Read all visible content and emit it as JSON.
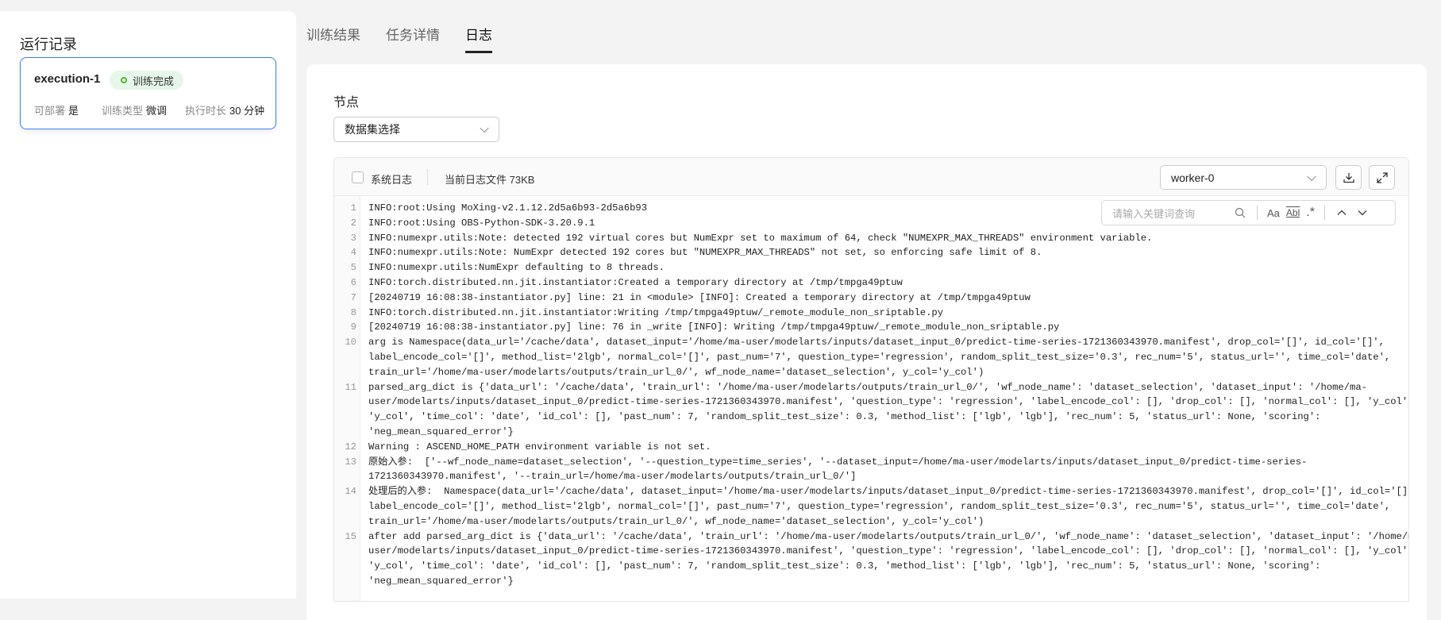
{
  "left": {
    "title": "运行记录",
    "card": {
      "name": "execution-1",
      "status": "训练完成",
      "deployable_label": "可部署",
      "deployable_value": "是",
      "type_label": "训练类型",
      "type_value": "微调",
      "duration_label": "执行时长",
      "duration_value": "30 分钟"
    }
  },
  "tabs": [
    {
      "label": "训练结果"
    },
    {
      "label": "任务详情"
    },
    {
      "label": "日志"
    }
  ],
  "node": {
    "label": "节点",
    "selected": "数据集选择"
  },
  "log": {
    "system_log_label": "系统日志",
    "file_info": "当前日志文件 73KB",
    "worker": "worker-0",
    "search_placeholder": "请输入关键词查询",
    "case_label": "Aa",
    "word_label": "Abl",
    "regex_label": ".*",
    "entries": [
      {
        "n": "1",
        "lines": [
          "INFO:root:Using MoXing-v2.1.12.2d5a6b93-2d5a6b93"
        ]
      },
      {
        "n": "2",
        "lines": [
          "INFO:root:Using OBS-Python-SDK-3.20.9.1"
        ]
      },
      {
        "n": "3",
        "lines": [
          "INFO:numexpr.utils:Note: detected 192 virtual cores but NumExpr set to maximum of 64, check \"NUMEXPR_MAX_THREADS\" environment variable."
        ]
      },
      {
        "n": "4",
        "lines": [
          "INFO:numexpr.utils:Note: NumExpr detected 192 cores but \"NUMEXPR_MAX_THREADS\" not set, so enforcing safe limit of 8."
        ]
      },
      {
        "n": "5",
        "lines": [
          "INFO:numexpr.utils:NumExpr defaulting to 8 threads."
        ]
      },
      {
        "n": "6",
        "lines": [
          "INFO:torch.distributed.nn.jit.instantiator:Created a temporary directory at /tmp/tmpga49ptuw"
        ]
      },
      {
        "n": "7",
        "lines": [
          "[20240719 16:08:38-instantiator.py] line: 21 in <module> [INFO]: Created a temporary directory at /tmp/tmpga49ptuw"
        ]
      },
      {
        "n": "8",
        "lines": [
          "INFO:torch.distributed.nn.jit.instantiator:Writing /tmp/tmpga49ptuw/_remote_module_non_sriptable.py"
        ]
      },
      {
        "n": "9",
        "lines": [
          "[20240719 16:08:38-instantiator.py] line: 76 in _write [INFO]: Writing /tmp/tmpga49ptuw/_remote_module_non_sriptable.py"
        ]
      },
      {
        "n": "10",
        "lines": [
          "arg is Namespace(data_url='/cache/data', dataset_input='/home/ma-user/modelarts/inputs/dataset_input_0/predict-time-series-1721360343970.manifest', drop_col='[]', id_col='[]',",
          "label_encode_col='[]', method_list='2lgb', normal_col='[]', past_num='7', question_type='regression', random_split_test_size='0.3', rec_num='5', status_url='', time_col='date',",
          "train_url='/home/ma-user/modelarts/outputs/train_url_0/', wf_node_name='dataset_selection', y_col='y_col')"
        ]
      },
      {
        "n": "11",
        "lines": [
          "parsed_arg_dict is {'data_url': '/cache/data', 'train_url': '/home/ma-user/modelarts/outputs/train_url_0/', 'wf_node_name': 'dataset_selection', 'dataset_input': '/home/ma-",
          "user/modelarts/inputs/dataset_input_0/predict-time-series-1721360343970.manifest', 'question_type': 'regression', 'label_encode_col': [], 'drop_col': [], 'normal_col': [], 'y_col':",
          "'y_col', 'time_col': 'date', 'id_col': [], 'past_num': 7, 'random_split_test_size': 0.3, 'method_list': ['lgb', 'lgb'], 'rec_num': 5, 'status_url': None, 'scoring':",
          "'neg_mean_squared_error'}"
        ]
      },
      {
        "n": "12",
        "lines": [
          "Warning : ASCEND_HOME_PATH environment variable is not set."
        ]
      },
      {
        "n": "13",
        "lines": [
          "原始入参:  ['--wf_node_name=dataset_selection', '--question_type=time_series', '--dataset_input=/home/ma-user/modelarts/inputs/dataset_input_0/predict-time-series-",
          "1721360343970.manifest', '--train_url=/home/ma-user/modelarts/outputs/train_url_0/']"
        ]
      },
      {
        "n": "14",
        "lines": [
          "处理后的入参:  Namespace(data_url='/cache/data', dataset_input='/home/ma-user/modelarts/inputs/dataset_input_0/predict-time-series-1721360343970.manifest', drop_col='[]', id_col='[]',",
          "label_encode_col='[]', method_list='2lgb', normal_col='[]', past_num='7', question_type='regression', random_split_test_size='0.3', rec_num='5', status_url='', time_col='date',",
          "train_url='/home/ma-user/modelarts/outputs/train_url_0/', wf_node_name='dataset_selection', y_col='y_col')"
        ]
      },
      {
        "n": "15",
        "lines": [
          "after add parsed_arg_dict is {'data_url': '/cache/data', 'train_url': '/home/ma-user/modelarts/outputs/train_url_0/', 'wf_node_name': 'dataset_selection', 'dataset_input': '/home/ma-",
          "user/modelarts/inputs/dataset_input_0/predict-time-series-1721360343970.manifest', 'question_type': 'regression', 'label_encode_col': [], 'drop_col': [], 'normal_col': [], 'y_col':",
          "'y_col', 'time_col': 'date', 'id_col': [], 'past_num': 7, 'random_split_test_size': 0.3, 'method_list': ['lgb', 'lgb'], 'rec_num': 5, 'status_url': None, 'scoring':",
          "'neg_mean_squared_error'}"
        ]
      }
    ]
  }
}
